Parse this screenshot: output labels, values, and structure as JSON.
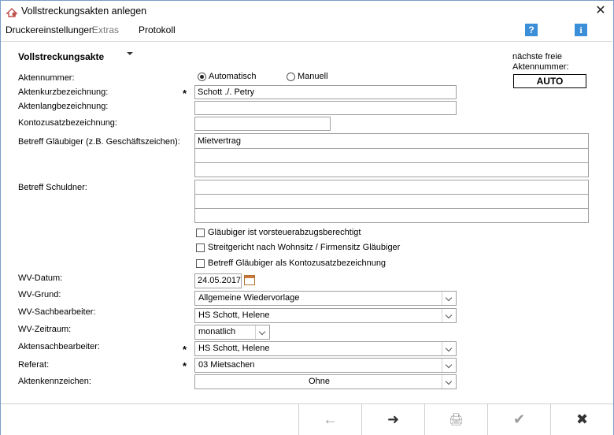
{
  "window": {
    "title": "Vollstreckungsakten anlegen",
    "close": "✕"
  },
  "menu": {
    "items": [
      "Druckereinstellungen",
      "Extras",
      "Protokoll"
    ],
    "help": "?",
    "info": "i"
  },
  "form": {
    "section_title": "Vollstreckungsakte",
    "next_free_label_1": "nächste freie",
    "next_free_label_2": "Aktennummer:",
    "next_free_value": "AUTO",
    "aktennummer": {
      "label": "Aktennummer:",
      "option_auto": "Automatisch",
      "option_manual": "Manuell",
      "selected": "Automatisch"
    },
    "kurzbez": {
      "label": "Aktenkurzbezeichnung:",
      "value": "Schott ./. Petry",
      "required": "*"
    },
    "langbez": {
      "label": "Aktenlangbezeichnung:",
      "value": ""
    },
    "kontozusatz": {
      "label": "Kontozusatzbezeichnung:",
      "value": ""
    },
    "betreff_glaeubiger": {
      "label": "Betreff Gläubiger (z.B. Geschäftszeichen):",
      "value": "Mietvertrag"
    },
    "betreff_schuldner": {
      "label": "Betreff Schuldner:",
      "value": ""
    },
    "checks": {
      "vorsteuer": "Gläubiger ist vorsteuerabzugsberechtigt",
      "streitgericht": "Streitgericht nach Wohnsitz / Firmensitz Gläubiger",
      "betreff_konto": "Betreff Gläubiger als Kontozusatzbezeichnung"
    },
    "wv_datum": {
      "label": "WV-Datum:",
      "value": "24.05.2017"
    },
    "wv_grund": {
      "label": "WV-Grund:",
      "value": "Allgemeine Wiedervorlage"
    },
    "wv_sachbearbeiter": {
      "label": "WV-Sachbearbeiter:",
      "value": "HS Schott, Helene"
    },
    "wv_zeitraum": {
      "label": "WV-Zeitraum:",
      "value": "monatlich"
    },
    "aktensachbearbeiter": {
      "label": "Aktensachbearbeiter:",
      "value": "HS Schott, Helene",
      "required": "*"
    },
    "referat": {
      "label": "Referat:",
      "value": "03 Mietsachen",
      "required": "*"
    },
    "aktenkennzeichen": {
      "label": "Aktenkennzeichen:",
      "value": "Ohne"
    }
  },
  "toolbar": {
    "back": "←",
    "forward": "➜",
    "print": "🖨",
    "ok": "✔",
    "cancel": "✖"
  }
}
